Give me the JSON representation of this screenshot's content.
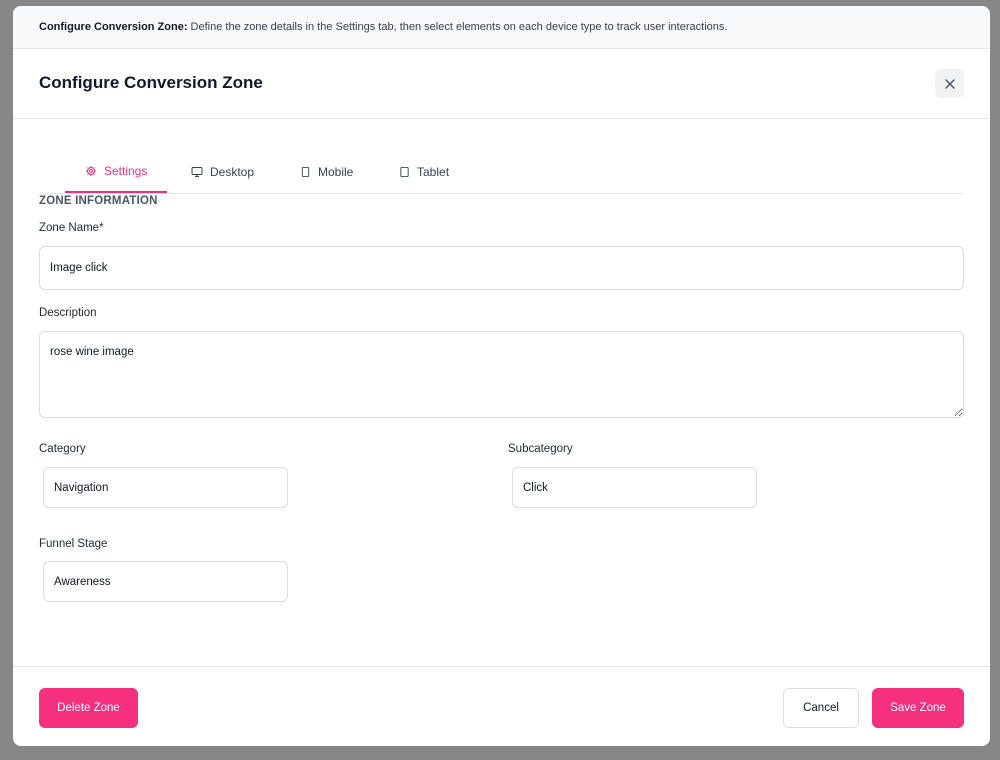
{
  "banner": {
    "bold": "Configure Conversion Zone:",
    "text": " Define the zone details in the Settings tab, then select elements on each device type to track user interactions."
  },
  "modal": {
    "title": "Configure Conversion Zone"
  },
  "tabs": [
    {
      "label": "Settings",
      "icon": "gear-icon",
      "active": true
    },
    {
      "label": "Desktop",
      "icon": "monitor-icon",
      "active": false
    },
    {
      "label": "Mobile",
      "icon": "smartphone-icon",
      "active": false
    },
    {
      "label": "Tablet",
      "icon": "tablet-icon",
      "active": false
    }
  ],
  "section": {
    "title": "ZONE INFORMATION"
  },
  "form": {
    "zone_name": {
      "label": "Zone Name*",
      "value": "Image click"
    },
    "description": {
      "label": "Description",
      "value": "rose wine image"
    },
    "category": {
      "label": "Category",
      "value": "Navigation"
    },
    "subcategory": {
      "label": "Subcategory",
      "value": "Click"
    },
    "funnel_stage": {
      "label": "Funnel Stage",
      "value": "Awareness"
    }
  },
  "footer": {
    "delete_label": "Delete Zone",
    "cancel_label": "Cancel",
    "save_label": "Save Zone"
  },
  "colors": {
    "accent": "#ec2f7f",
    "button_pink": "#f5307f",
    "overlay": "#878787"
  }
}
